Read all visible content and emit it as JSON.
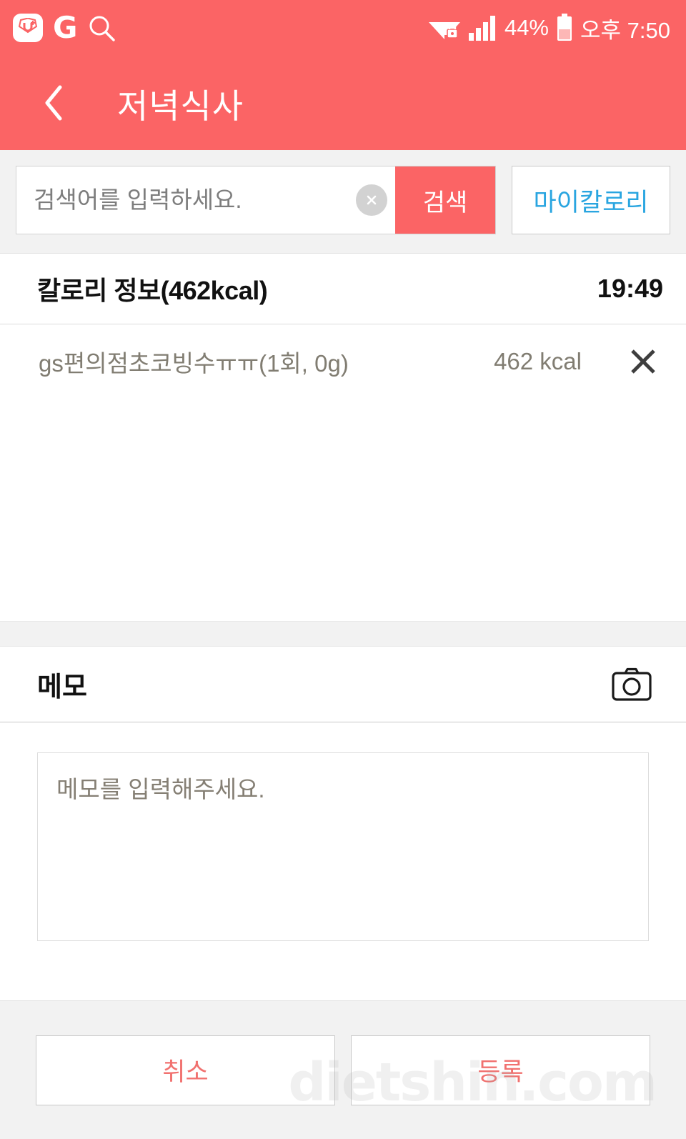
{
  "statusbar": {
    "carrier_icon": "uplus-app-icon",
    "carrier_glyph": "U+",
    "google_glyph": "G",
    "search_icon": "search-icon",
    "wifi_icon": "wifi-locked-icon",
    "signal_icon": "cellular-signal-icon",
    "battery_percent": "44%",
    "battery_icon": "battery-icon",
    "time": "오후 7:50"
  },
  "appbar": {
    "back_icon": "chevron-left-icon",
    "title": "저녁식사"
  },
  "search": {
    "placeholder": "검색어를 입력하세요.",
    "value": "",
    "clear_icon": "clear-circle-x-icon",
    "search_label": "검색",
    "mycalorie_label": "마이칼로리"
  },
  "calorie_section": {
    "title": "칼로리 정보(462kcal)",
    "time": "19:49",
    "items": [
      {
        "name": "gs편의점초코빙수ㅠㅠ(1회, 0g)",
        "kcal": "462 kcal",
        "delete_icon": "close-x-icon"
      }
    ]
  },
  "memo": {
    "title": "메모",
    "camera_icon": "camera-icon",
    "placeholder": "메모를 입력해주세요.",
    "value": ""
  },
  "actions": {
    "cancel_label": "취소",
    "submit_label": "등록"
  },
  "watermark": {
    "text": "dietshin.com"
  },
  "colors": {
    "brand_red": "#fb6465",
    "action_red": "#f1716f",
    "link_blue": "#29a5e0",
    "panel_gray": "#f2f2f2",
    "food_text": "#817d72"
  }
}
